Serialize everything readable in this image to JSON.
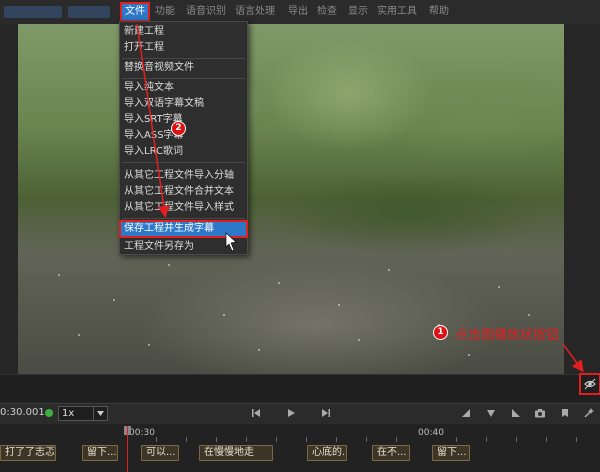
{
  "menubar": {
    "items": [
      {
        "label": "文件",
        "active": true
      },
      {
        "label": "功能"
      },
      {
        "label": "语音识别"
      },
      {
        "label": "语言处理"
      },
      {
        "label": "导出"
      },
      {
        "label": "检查"
      },
      {
        "label": "显示"
      },
      {
        "label": "实用工具"
      },
      {
        "label": "帮助"
      }
    ]
  },
  "file_menu": {
    "items": [
      {
        "label": "新建工程"
      },
      {
        "label": "打开工程"
      },
      {
        "label": "替换音视频文件"
      },
      {
        "label": "导入纯文本"
      },
      {
        "label": "导入双语字幕文稿"
      },
      {
        "label": "导入SRT字幕"
      },
      {
        "label": "导入ASS字幕"
      },
      {
        "label": "导入LRC歌词"
      },
      {
        "label": "从其它工程文件导入分轴"
      },
      {
        "label": "从其它工程文件合并文本"
      },
      {
        "label": "从其它工程文件导入样式"
      },
      {
        "label": "保存工程并生成字幕",
        "highlighted": true
      },
      {
        "label": "工程文件另存为"
      }
    ]
  },
  "annotations": {
    "badge_1": "1",
    "badge_2": "2",
    "hint": "点击图播放状按钮"
  },
  "playback": {
    "time": "0:30.001",
    "speed": "1x",
    "status_color": "#3cb043"
  },
  "timeline": {
    "ruler_labels": [
      "00:30",
      "00:40"
    ],
    "segments": [
      "打了了志忑",
      "留下...",
      "可以...",
      "在慢慢地走",
      "心底的..",
      "在不...",
      "留下..."
    ]
  },
  "colors": {
    "accent": "#2d78c8",
    "annotation_red": "#e02020"
  }
}
